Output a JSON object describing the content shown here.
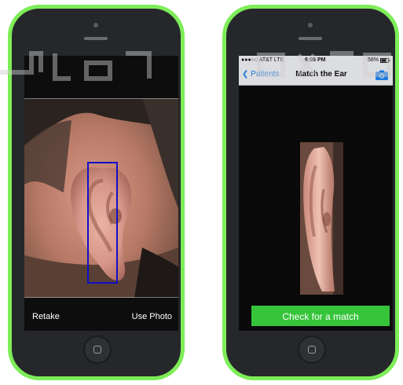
{
  "left_phone": {
    "retake_label": "Retake",
    "use_photo_label": "Use Photo"
  },
  "right_phone": {
    "status": {
      "carrier": "●●●○○ AT&T  LTE",
      "time": "6:05 PM",
      "battery": "58%"
    },
    "nav": {
      "back_label": "Patients",
      "title": "Match the Ear",
      "camera_icon": "camera-icon"
    },
    "match_button_label": "Check for a match"
  },
  "colors": {
    "phone_shell": "#7ded58",
    "crop_box": "#1010c8",
    "ios_blue": "#1a7ae0",
    "match_button": "#36c43a"
  }
}
